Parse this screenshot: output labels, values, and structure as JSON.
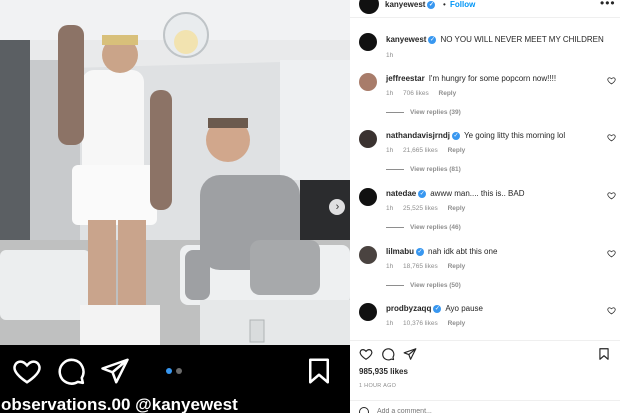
{
  "post": {
    "username": "kanyewest",
    "follow_separator": "•",
    "follow_label": "Follow",
    "more_label": "•••",
    "caption_text": "NO YOU WILL NEVER MEET MY CHILDREN",
    "caption_time": "1h",
    "carousel": {
      "total_slides": 2,
      "active_slide": 1
    },
    "overlay_caption": "observations.00 @kanyewest"
  },
  "comments": [
    {
      "username": "jeffreestar",
      "verified": false,
      "text": "I'm hungry for some popcorn now!!!!",
      "time": "1h",
      "likes": "706 likes",
      "reply_label": "Reply",
      "view_replies": "View replies (39)"
    },
    {
      "username": "nathandavisjrndj",
      "verified": true,
      "text": "Ye going litty this morning lol",
      "time": "1h",
      "likes": "21,665 likes",
      "reply_label": "Reply",
      "view_replies": "View replies (81)"
    },
    {
      "username": "natedae",
      "verified": true,
      "text": "awww man.... this is.. BAD",
      "time": "1h",
      "likes": "25,525 likes",
      "reply_label": "Reply",
      "view_replies": "View replies (46)"
    },
    {
      "username": "lilmabu",
      "verified": true,
      "text": "nah idk abt this one",
      "time": "1h",
      "likes": "18,765 likes",
      "reply_label": "Reply",
      "view_replies": "View replies (50)"
    },
    {
      "username": "prodbyzaqq",
      "verified": true,
      "text": "Ayo pause",
      "time": "1h",
      "likes": "10,376 likes",
      "reply_label": "Reply"
    }
  ],
  "footer": {
    "likes_count": "985,935 likes",
    "time_ago": "1 HOUR AGO",
    "add_comment_placeholder": "Add a comment..."
  },
  "icons": {
    "like": "heart-icon",
    "comment": "comment-icon",
    "share": "paper-plane-icon",
    "save": "bookmark-icon",
    "verified": "verified-badge-icon",
    "next": "chevron-right-icon"
  },
  "colors": {
    "link_blue": "#0095f6",
    "verified_blue": "#3897f0",
    "muted_text": "#8e8e8e",
    "primary_text": "#262626"
  }
}
